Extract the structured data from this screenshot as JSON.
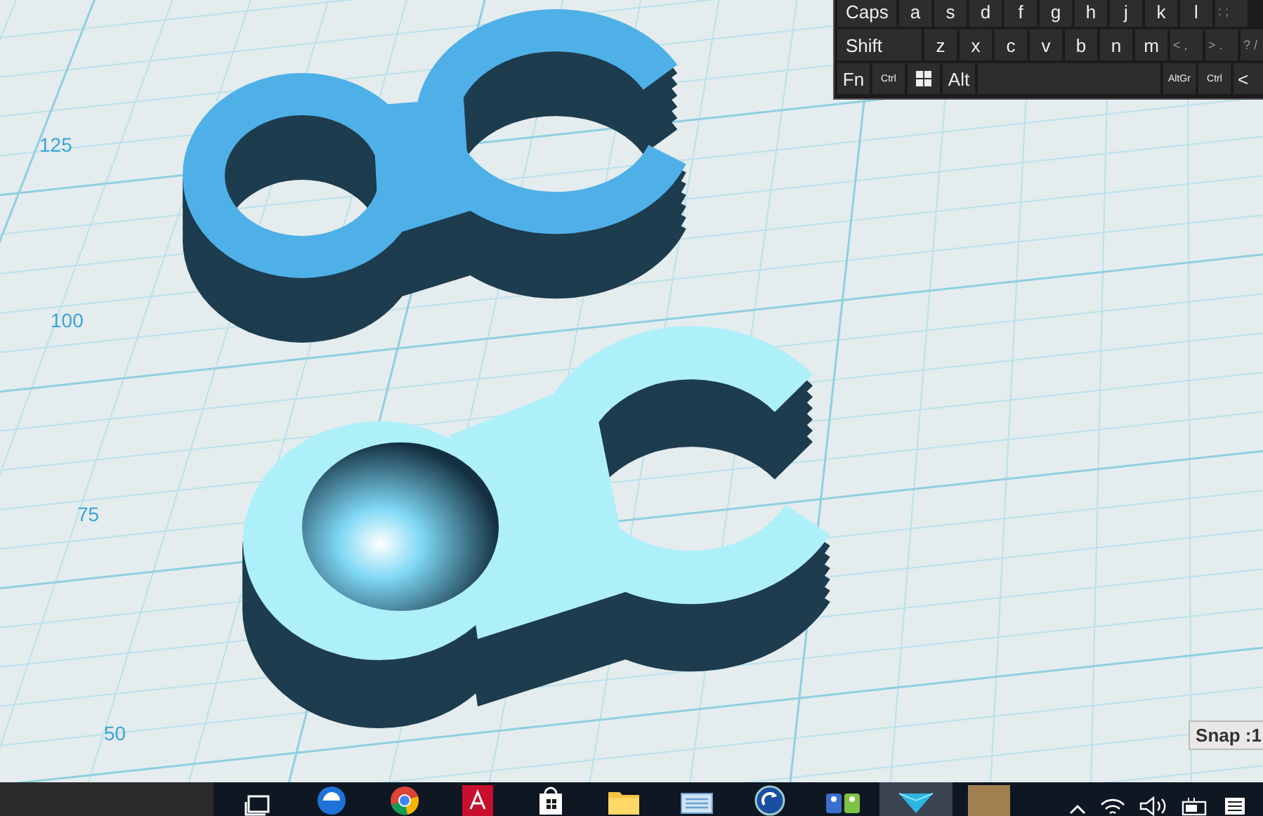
{
  "viewport": {
    "axis_labels": [
      "125",
      "100",
      "75",
      "50"
    ],
    "snap": "Snap :1"
  },
  "keyboard": {
    "rows": [
      [
        {
          "kind": "caps",
          "label": "Caps"
        },
        {
          "kind": "key",
          "label": "a"
        },
        {
          "kind": "key",
          "label": "s"
        },
        {
          "kind": "key",
          "label": "d"
        },
        {
          "kind": "key",
          "label": "f"
        },
        {
          "kind": "key",
          "label": "g"
        },
        {
          "kind": "key",
          "label": "h"
        },
        {
          "kind": "key",
          "label": "j"
        },
        {
          "kind": "key",
          "label": "k"
        },
        {
          "kind": "key",
          "label": "l"
        },
        {
          "kind": "symbol",
          "label": ": ;"
        }
      ],
      [
        {
          "kind": "shift",
          "label": "Shift"
        },
        {
          "kind": "key",
          "label": "z"
        },
        {
          "kind": "key",
          "label": "x"
        },
        {
          "kind": "key",
          "label": "c"
        },
        {
          "kind": "key",
          "label": "v"
        },
        {
          "kind": "key",
          "label": "b"
        },
        {
          "kind": "key",
          "label": "n"
        },
        {
          "kind": "key",
          "label": "m"
        },
        {
          "kind": "symbol",
          "label": "< ,"
        },
        {
          "kind": "symbol",
          "label": "> ."
        },
        {
          "kind": "symbol",
          "label": "? /"
        }
      ],
      [
        {
          "kind": "key",
          "label": "Fn"
        },
        {
          "kind": "small",
          "label": "Ctrl"
        },
        {
          "kind": "windows"
        },
        {
          "kind": "key",
          "label": "Alt"
        },
        {
          "kind": "space"
        },
        {
          "kind": "small",
          "label": "AltGr"
        },
        {
          "kind": "small",
          "label": "Ctrl"
        },
        {
          "kind": "key",
          "label": "<"
        }
      ]
    ]
  },
  "taskbar": {
    "apps": [
      {
        "kind": "task-view",
        "selected": false
      },
      {
        "kind": "edge",
        "selected": false
      },
      {
        "kind": "chrome",
        "selected": false
      },
      {
        "kind": "acrobat",
        "selected": false
      },
      {
        "kind": "store",
        "selected": false
      },
      {
        "kind": "folder",
        "selected": false
      },
      {
        "kind": "keyboard",
        "selected": false
      },
      {
        "kind": "refresh",
        "selected": false
      },
      {
        "kind": "people",
        "selected": false
      },
      {
        "kind": "model",
        "selected": true
      },
      {
        "kind": "photo",
        "selected": false
      }
    ],
    "tray": [
      {
        "kind": "chevron"
      },
      {
        "kind": "wifi"
      },
      {
        "kind": "volume"
      },
      {
        "kind": "battery"
      },
      {
        "kind": "notes"
      }
    ]
  }
}
